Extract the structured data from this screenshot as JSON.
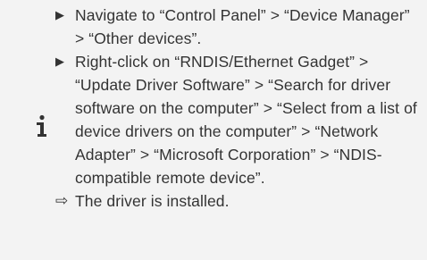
{
  "steps": [
    {
      "text": "Navigate to “Control Panel” > “Device Manager” > “Other devices”."
    },
    {
      "text": "Right-click on “RNDIS/Ethernet Gadget” > “Update Driver Software” > “Search for driver software on the computer” > “Se­lect from a list of device drivers on the computer” > “Network Adapter” > “Mi­crosoft Corporation” > “NDIS-compatible remote device”."
    }
  ],
  "result": "The driver is installed.",
  "icons": {
    "info": "info-icon",
    "step_marker": "▶",
    "result_marker": "⇨"
  }
}
